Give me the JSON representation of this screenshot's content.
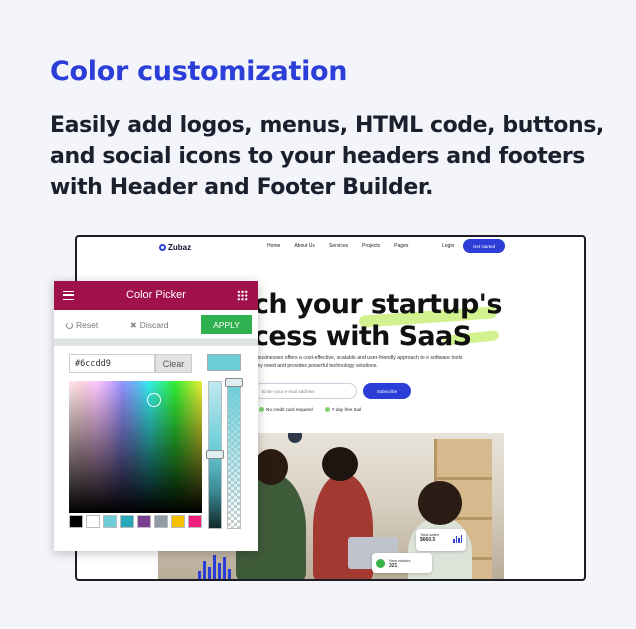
{
  "header": {
    "title": "Color customization",
    "description": "Easily add logos, menus, HTML code, buttons, and social icons to your headers and footers with Header and Footer Builder."
  },
  "site_preview": {
    "logo_text": "Zubaz",
    "nav_links": [
      "Home",
      "About Us",
      "Services",
      "Projects",
      "Pages"
    ],
    "login_label": "Login",
    "cta_label": "Get started",
    "hero_line_1": "ch your startup's",
    "hero_line_2": "cess with SaaS",
    "subtext": "e businesses offers a cost-effective, scalable and user-friendly approach to e software tools they need and provides powerful technology solutions.",
    "email_placeholder": "Enter your e-mail address",
    "subscribe_label": "Subscribe",
    "check_1": "No credit card required",
    "check_2": "7-day free trial",
    "stat_card_1_label": "Total sales",
    "stat_card_1_value": "$660.5",
    "stat_card_2_label": "New visitors",
    "stat_card_2_value": "321"
  },
  "color_picker": {
    "title": "Color Picker",
    "reset_label": "Reset",
    "discard_label": "Discard",
    "apply_label": "APPLY",
    "hex_value": "#6ccdd9",
    "clear_label": "Clear",
    "current_color": "#6ccdd9",
    "swatches": [
      "#000000",
      "#ffffff",
      "#6ccdd9",
      "#2aa7b8",
      "#7b3f8f",
      "#8e9aa6",
      "#f6c000",
      "#f01e7c"
    ],
    "header_color": "#a0104a",
    "apply_color": "#2fb14f"
  },
  "colors": {
    "accent": "#2b3ed8",
    "highlight": "#c9f07a"
  }
}
